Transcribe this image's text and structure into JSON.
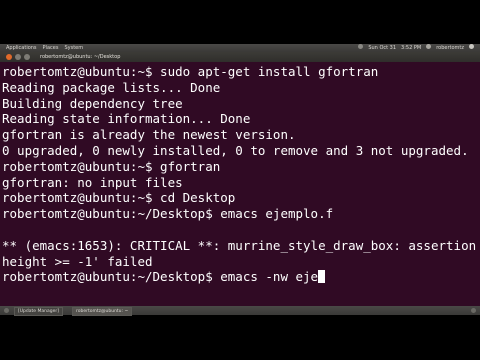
{
  "top_panel": {
    "menu": [
      "Applications",
      "Places",
      "System"
    ],
    "tray": [
      "Sun Oct 31",
      "3:52 PM",
      "robertomtz"
    ]
  },
  "window": {
    "title": "robertomtz@ubuntu: ~/Desktop"
  },
  "terminal": {
    "lines": [
      "robertomtz@ubuntu:~$ sudo apt-get install gfortran",
      "Reading package lists... Done",
      "Building dependency tree",
      "Reading state information... Done",
      "gfortran is already the newest version.",
      "0 upgraded, 0 newly installed, 0 to remove and 3 not upgraded.",
      "robertomtz@ubuntu:~$ gfortran",
      "gfortran: no input files",
      "robertomtz@ubuntu:~$ cd Desktop",
      "robertomtz@ubuntu:~/Desktop$ emacs ejemplo.f",
      "",
      "** (emacs:1653): CRITICAL **: murrine_style_draw_box: assertion `",
      "height >= -1' failed",
      "robertomtz@ubuntu:~/Desktop$ emacs -nw eje"
    ]
  },
  "bottom_panel": {
    "tasks": [
      "[Update Manager]",
      "robertomtz@ubuntu: ~"
    ]
  }
}
